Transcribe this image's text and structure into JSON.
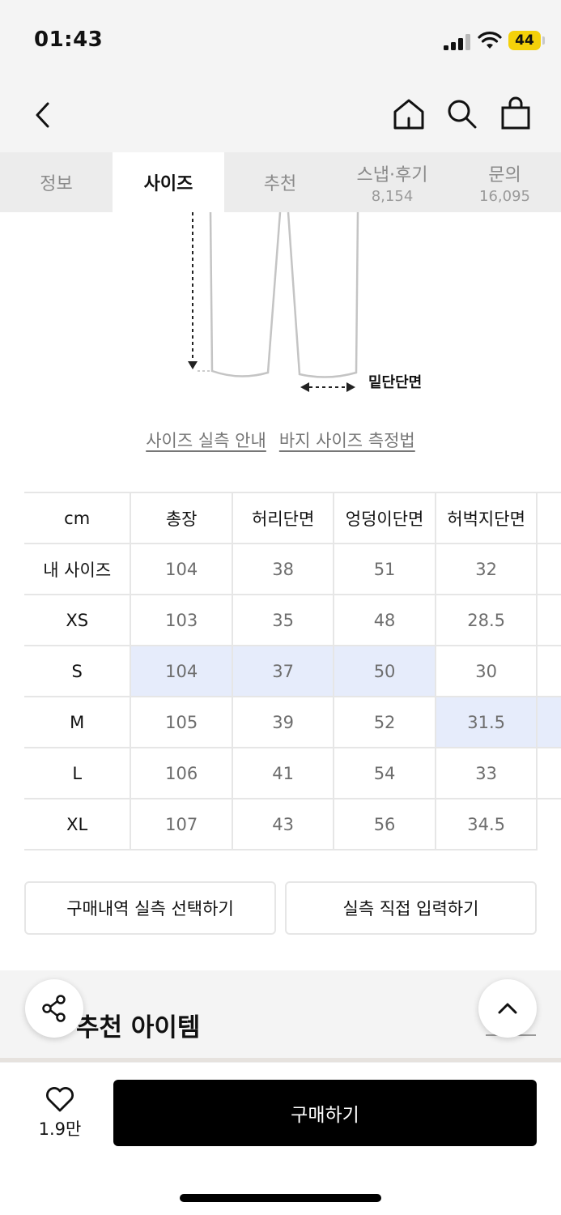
{
  "status_bar": {
    "time": "01:43",
    "battery": "44"
  },
  "header": {
    "back_icon": "chevron-left-icon",
    "icons": [
      "home-icon",
      "search-icon",
      "shopping-bag-icon"
    ]
  },
  "tabs": [
    {
      "label": "정보",
      "count": ""
    },
    {
      "label": "사이즈",
      "count": "",
      "active": true
    },
    {
      "label": "추천",
      "count": ""
    },
    {
      "label": "스냅·후기",
      "count": "8,154"
    },
    {
      "label": "문의",
      "count": "16,095"
    }
  ],
  "diagram": {
    "hem_label": "밑단단면"
  },
  "links": {
    "size_guide": "사이즈 실측 안내",
    "pants_measure": "바지 사이즈 측정법"
  },
  "size_table": {
    "headers": [
      "cm",
      "총장",
      "허리단면",
      "엉덩이단면",
      "허벅지단면"
    ],
    "rows": [
      {
        "label": "내 사이즈",
        "values": [
          "104",
          "38",
          "51",
          "32"
        ]
      },
      {
        "label": "XS",
        "values": [
          "103",
          "35",
          "48",
          "28.5"
        ]
      },
      {
        "label": "S",
        "values": [
          "104",
          "37",
          "50",
          "30"
        ]
      },
      {
        "label": "M",
        "values": [
          "105",
          "39",
          "52",
          "31.5"
        ]
      },
      {
        "label": "L",
        "values": [
          "106",
          "41",
          "54",
          "33"
        ]
      },
      {
        "label": "XL",
        "values": [
          "107",
          "43",
          "56",
          "34.5"
        ]
      }
    ],
    "highlight_color": "#e6ecfb"
  },
  "buttons": {
    "select_history": "구매내역 실측 선택하기",
    "direct_input": "실측 직접 입력하기"
  },
  "recommend": {
    "title": "추천 아이템"
  },
  "bottom_bar": {
    "like_count": "1.9만",
    "buy_label": "구매하기",
    "buy_color": "#000000"
  }
}
